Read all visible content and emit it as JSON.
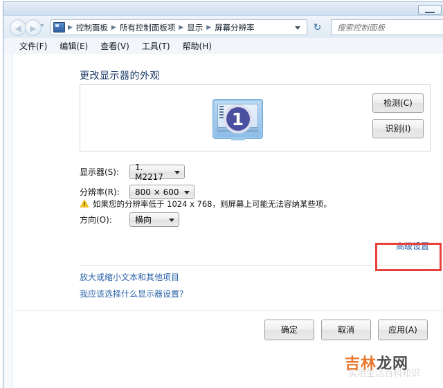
{
  "window": {
    "minimize_label": "—"
  },
  "navbar": {
    "back_glyph": "◀",
    "forward_glyph": "▶",
    "breadcrumbs": [
      "控制面板",
      "所有控制面板项",
      "显示",
      "屏幕分辨率"
    ],
    "separator": "▶",
    "address_icon": "control-panel-icon",
    "refresh_glyph": "↻",
    "search_placeholder": "搜索控制面板",
    "search_value": ""
  },
  "menubar": {
    "items": [
      "文件(F)",
      "编辑(E)",
      "查看(V)",
      "工具(T)",
      "帮助(H)"
    ]
  },
  "page": {
    "title": "更改显示器的外观"
  },
  "preview": {
    "monitor_number": "1",
    "detect_button": "检测(C)",
    "identify_button": "识别(I)"
  },
  "form": {
    "display_label": "显示器(S):",
    "display_value": "1. M2217",
    "resolution_label": "分辨率(R):",
    "resolution_value": "800 × 600",
    "warning_text": "如果您的分辨率低于 1024 x 768，则屏幕上可能无法容纳某些项。",
    "orientation_label": "方向(O):",
    "orientation_value": "横向",
    "advanced_link": "高级设置"
  },
  "links": {
    "text_size": "放大或缩小文本和其他项目",
    "help": "我应该选择什么显示器设置?"
  },
  "footer": {
    "ok": "确定",
    "cancel": "取消",
    "apply": "应用(A)"
  },
  "watermark": {
    "part1": "吉林",
    "part2": "龙网",
    "subtitle": "实用生活百科知识"
  },
  "colors": {
    "accent_link": "#2a63a8",
    "highlight_box": "#e8403a",
    "warning": "#f2c327",
    "watermark_orange": "#e8762b"
  }
}
